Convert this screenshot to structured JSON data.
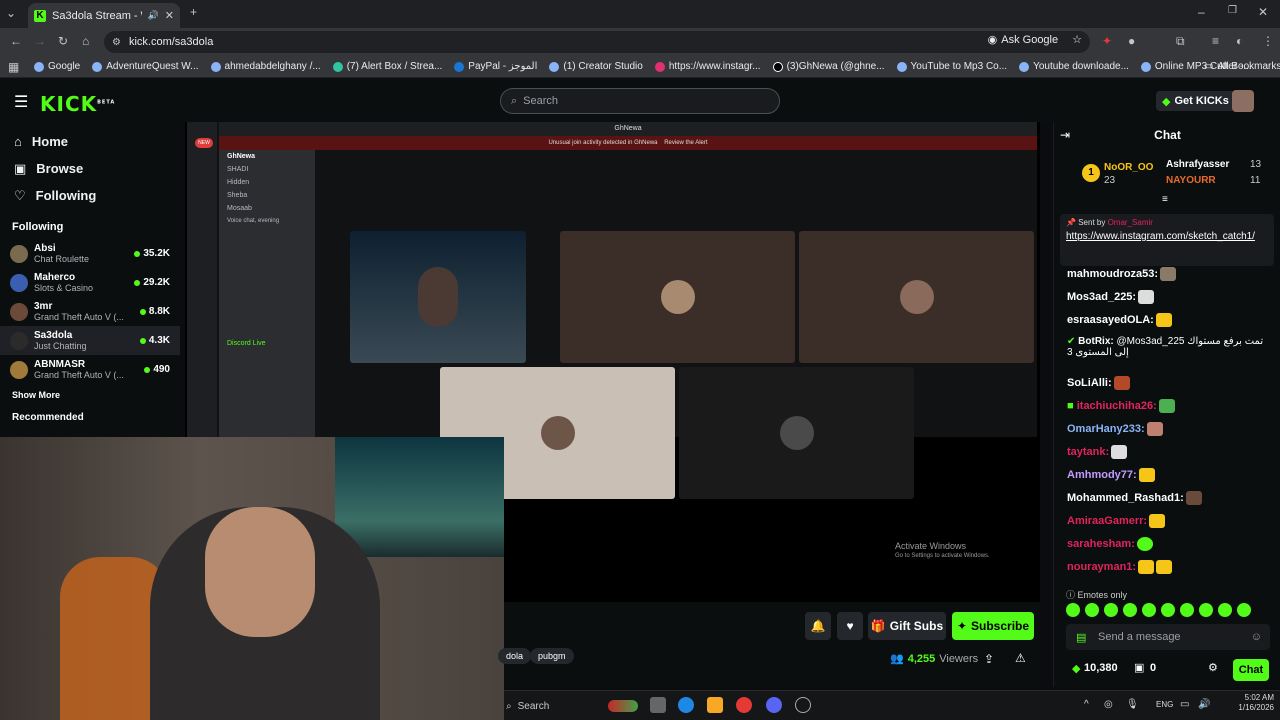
{
  "browser": {
    "tab_title": "Sa3dola Stream - Watch Liv",
    "url": "kick.com/sa3dola",
    "ask_google": "Ask Google",
    "bookmarks": [
      "Google",
      "AdventureQuest W...",
      "ahmedabdelghany /...",
      "(7) Alert Box / Strea...",
      "PayPal - الموجز",
      "(1) Creator Studio",
      "https://www.instagr...",
      "(3)GhNewa (@ghne...",
      "YouTube to Mp3 Co...",
      "Youtube downloade...",
      "Online MP3 Cutter -..."
    ],
    "all_bookmarks": "All Bookmarks"
  },
  "header": {
    "logo": "KICK",
    "logo_badge": "BETA",
    "search_placeholder": "Search",
    "get_kicks": "Get KICKs"
  },
  "sidebar": {
    "nav": [
      {
        "label": "Home",
        "icon": "home-icon"
      },
      {
        "label": "Browse",
        "icon": "browse-icon"
      },
      {
        "label": "Following",
        "icon": "heart-icon"
      }
    ],
    "following_title": "Following",
    "following": [
      {
        "name": "Absi",
        "sub": "Chat Roulette",
        "count": "35.2K"
      },
      {
        "name": "Maherco",
        "sub": "Slots & Casino",
        "count": "29.2K"
      },
      {
        "name": "3mr",
        "sub": "Grand Theft Auto V (...",
        "count": "8.8K"
      },
      {
        "name": "Sa3dola",
        "sub": "Just Chatting",
        "count": "4.3K"
      },
      {
        "name": "ABNMASR",
        "sub": "Grand Theft Auto V (...",
        "count": "490"
      }
    ],
    "show_more": "Show More",
    "recommended": "Recommended"
  },
  "discord": {
    "title": "GhNewa",
    "alert": "Unusual join activity detected in GhNewa",
    "review": "Review the Alert",
    "server_name": "GhNewa",
    "channels": [
      "SHADI",
      "Hidden",
      "Sheba",
      "Mosaab",
      "Voice chat, evening",
      "Discord Live"
    ],
    "new_badge": "NEW"
  },
  "windows_mark": {
    "line1": "Activate Windows",
    "line2": "Go to Settings to activate Windows."
  },
  "player": {
    "gift_subs": "Gift Subs",
    "subscribe": "Subscribe",
    "tags": [
      "dola",
      "pubgm"
    ],
    "viewers_count": "4,255",
    "viewers_label": "Viewers"
  },
  "chat": {
    "title": "Chat",
    "gifters": [
      {
        "name": "NoOR_OO",
        "count": "23",
        "rank": "1"
      },
      {
        "name": "Ashrafyasser",
        "count": "13"
      },
      {
        "name": "NAYOURR",
        "count": "11"
      }
    ],
    "pinned_by_label": "Sent by",
    "pinned_by": "Omar_Samir",
    "pinned_link": "https://www.instagram.com/sketch_catch1/",
    "messages": [
      {
        "user": "mahmoudroza53:",
        "color": "#ffffff",
        "text": ""
      },
      {
        "user": "Mos3ad_225:",
        "color": "#ffffff",
        "text": ""
      },
      {
        "user": "esraasayedOLA:",
        "color": "#ffffff",
        "text": ""
      },
      {
        "user": "BotRix:",
        "color": "#ffffff",
        "text": "@Mos3ad_225 تمت برفع مستواك إلى المستوى 3"
      },
      {
        "user": "SoLiAlli:",
        "color": "#ffffff",
        "text": ""
      },
      {
        "user": "itachiuchiha26:",
        "color": "#e0245e",
        "text": ""
      },
      {
        "user": "OmarHany233:",
        "color": "#ffffff",
        "text": ""
      },
      {
        "user": "taytank:",
        "color": "#e0245e",
        "text": ""
      },
      {
        "user": "Amhmody77:",
        "color": "#ffffff",
        "text": ""
      },
      {
        "user": "Mohammed_Rashad1:",
        "color": "#ffffff",
        "text": ""
      },
      {
        "user": "AmiraaGamerr:",
        "color": "#e0245e",
        "text": ""
      },
      {
        "user": "sarahesham:",
        "color": "#e0245e",
        "text": ""
      },
      {
        "user": "nourayman1:",
        "color": "#e0245e",
        "text": ""
      }
    ],
    "emotes_only": "Emotes only",
    "input_placeholder": "Send a message",
    "kicks_balance": "10,380",
    "gift_count": "0",
    "chat_button": "Chat"
  },
  "taskbar": {
    "search": "Search",
    "lang": "ENG",
    "time": "5:02 AM",
    "date": "1/16/2026"
  },
  "colors": {
    "accent": "#53fc18",
    "bg": "#0b0e0f"
  }
}
